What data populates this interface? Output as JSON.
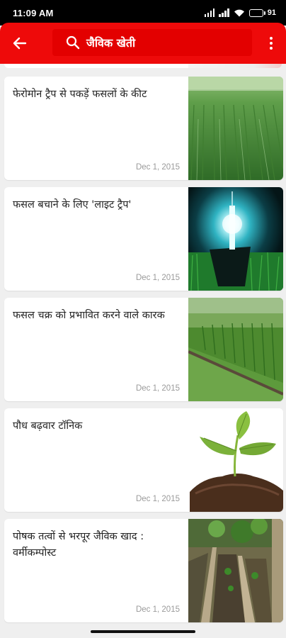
{
  "status_bar": {
    "time": "11:09 AM",
    "battery": "91",
    "icons": [
      "signal-icon",
      "signal-icon",
      "wifi-icon",
      "battery-icon"
    ]
  },
  "app_bar": {
    "search_query": "जैविक खेती",
    "back_icon": "arrow-left-icon",
    "search_icon": "search-icon",
    "menu_icon": "more-vertical-icon",
    "color": "#ee0a0a"
  },
  "articles": [
    {
      "title": "फेरोमोन ट्रैप से पकड़ें फसलों के कीट",
      "date": "Dec 1, 2015"
    },
    {
      "title": "फसल बचाने के लिए 'लाइट ट्रैप'",
      "date": "Dec 1, 2015"
    },
    {
      "title": "फसल चक्र को प्रभावित करने वाले कारक",
      "date": "Dec 1, 2015"
    },
    {
      "title": "पौध बढ़वार टॉनिक",
      "date": "Dec 1, 2015"
    },
    {
      "title": "पोषक तत्वों से भरपूर जैविक खाद : वर्मीकम्पोस्ट",
      "date": "Dec 1, 2015"
    }
  ]
}
